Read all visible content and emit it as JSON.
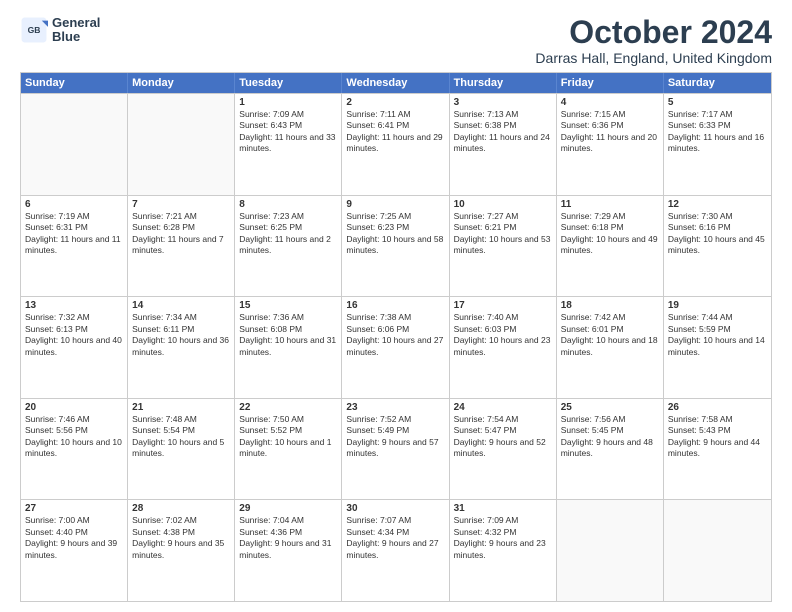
{
  "header": {
    "logo_line1": "General",
    "logo_line2": "Blue",
    "month_title": "October 2024",
    "location": "Darras Hall, England, United Kingdom"
  },
  "days_of_week": [
    "Sunday",
    "Monday",
    "Tuesday",
    "Wednesday",
    "Thursday",
    "Friday",
    "Saturday"
  ],
  "weeks": [
    [
      {
        "day": "",
        "sunrise": "",
        "sunset": "",
        "daylight": ""
      },
      {
        "day": "",
        "sunrise": "",
        "sunset": "",
        "daylight": ""
      },
      {
        "day": "1",
        "sunrise": "Sunrise: 7:09 AM",
        "sunset": "Sunset: 6:43 PM",
        "daylight": "Daylight: 11 hours and 33 minutes."
      },
      {
        "day": "2",
        "sunrise": "Sunrise: 7:11 AM",
        "sunset": "Sunset: 6:41 PM",
        "daylight": "Daylight: 11 hours and 29 minutes."
      },
      {
        "day": "3",
        "sunrise": "Sunrise: 7:13 AM",
        "sunset": "Sunset: 6:38 PM",
        "daylight": "Daylight: 11 hours and 24 minutes."
      },
      {
        "day": "4",
        "sunrise": "Sunrise: 7:15 AM",
        "sunset": "Sunset: 6:36 PM",
        "daylight": "Daylight: 11 hours and 20 minutes."
      },
      {
        "day": "5",
        "sunrise": "Sunrise: 7:17 AM",
        "sunset": "Sunset: 6:33 PM",
        "daylight": "Daylight: 11 hours and 16 minutes."
      }
    ],
    [
      {
        "day": "6",
        "sunrise": "Sunrise: 7:19 AM",
        "sunset": "Sunset: 6:31 PM",
        "daylight": "Daylight: 11 hours and 11 minutes."
      },
      {
        "day": "7",
        "sunrise": "Sunrise: 7:21 AM",
        "sunset": "Sunset: 6:28 PM",
        "daylight": "Daylight: 11 hours and 7 minutes."
      },
      {
        "day": "8",
        "sunrise": "Sunrise: 7:23 AM",
        "sunset": "Sunset: 6:25 PM",
        "daylight": "Daylight: 11 hours and 2 minutes."
      },
      {
        "day": "9",
        "sunrise": "Sunrise: 7:25 AM",
        "sunset": "Sunset: 6:23 PM",
        "daylight": "Daylight: 10 hours and 58 minutes."
      },
      {
        "day": "10",
        "sunrise": "Sunrise: 7:27 AM",
        "sunset": "Sunset: 6:21 PM",
        "daylight": "Daylight: 10 hours and 53 minutes."
      },
      {
        "day": "11",
        "sunrise": "Sunrise: 7:29 AM",
        "sunset": "Sunset: 6:18 PM",
        "daylight": "Daylight: 10 hours and 49 minutes."
      },
      {
        "day": "12",
        "sunrise": "Sunrise: 7:30 AM",
        "sunset": "Sunset: 6:16 PM",
        "daylight": "Daylight: 10 hours and 45 minutes."
      }
    ],
    [
      {
        "day": "13",
        "sunrise": "Sunrise: 7:32 AM",
        "sunset": "Sunset: 6:13 PM",
        "daylight": "Daylight: 10 hours and 40 minutes."
      },
      {
        "day": "14",
        "sunrise": "Sunrise: 7:34 AM",
        "sunset": "Sunset: 6:11 PM",
        "daylight": "Daylight: 10 hours and 36 minutes."
      },
      {
        "day": "15",
        "sunrise": "Sunrise: 7:36 AM",
        "sunset": "Sunset: 6:08 PM",
        "daylight": "Daylight: 10 hours and 31 minutes."
      },
      {
        "day": "16",
        "sunrise": "Sunrise: 7:38 AM",
        "sunset": "Sunset: 6:06 PM",
        "daylight": "Daylight: 10 hours and 27 minutes."
      },
      {
        "day": "17",
        "sunrise": "Sunrise: 7:40 AM",
        "sunset": "Sunset: 6:03 PM",
        "daylight": "Daylight: 10 hours and 23 minutes."
      },
      {
        "day": "18",
        "sunrise": "Sunrise: 7:42 AM",
        "sunset": "Sunset: 6:01 PM",
        "daylight": "Daylight: 10 hours and 18 minutes."
      },
      {
        "day": "19",
        "sunrise": "Sunrise: 7:44 AM",
        "sunset": "Sunset: 5:59 PM",
        "daylight": "Daylight: 10 hours and 14 minutes."
      }
    ],
    [
      {
        "day": "20",
        "sunrise": "Sunrise: 7:46 AM",
        "sunset": "Sunset: 5:56 PM",
        "daylight": "Daylight: 10 hours and 10 minutes."
      },
      {
        "day": "21",
        "sunrise": "Sunrise: 7:48 AM",
        "sunset": "Sunset: 5:54 PM",
        "daylight": "Daylight: 10 hours and 5 minutes."
      },
      {
        "day": "22",
        "sunrise": "Sunrise: 7:50 AM",
        "sunset": "Sunset: 5:52 PM",
        "daylight": "Daylight: 10 hours and 1 minute."
      },
      {
        "day": "23",
        "sunrise": "Sunrise: 7:52 AM",
        "sunset": "Sunset: 5:49 PM",
        "daylight": "Daylight: 9 hours and 57 minutes."
      },
      {
        "day": "24",
        "sunrise": "Sunrise: 7:54 AM",
        "sunset": "Sunset: 5:47 PM",
        "daylight": "Daylight: 9 hours and 52 minutes."
      },
      {
        "day": "25",
        "sunrise": "Sunrise: 7:56 AM",
        "sunset": "Sunset: 5:45 PM",
        "daylight": "Daylight: 9 hours and 48 minutes."
      },
      {
        "day": "26",
        "sunrise": "Sunrise: 7:58 AM",
        "sunset": "Sunset: 5:43 PM",
        "daylight": "Daylight: 9 hours and 44 minutes."
      }
    ],
    [
      {
        "day": "27",
        "sunrise": "Sunrise: 7:00 AM",
        "sunset": "Sunset: 4:40 PM",
        "daylight": "Daylight: 9 hours and 39 minutes."
      },
      {
        "day": "28",
        "sunrise": "Sunrise: 7:02 AM",
        "sunset": "Sunset: 4:38 PM",
        "daylight": "Daylight: 9 hours and 35 minutes."
      },
      {
        "day": "29",
        "sunrise": "Sunrise: 7:04 AM",
        "sunset": "Sunset: 4:36 PM",
        "daylight": "Daylight: 9 hours and 31 minutes."
      },
      {
        "day": "30",
        "sunrise": "Sunrise: 7:07 AM",
        "sunset": "Sunset: 4:34 PM",
        "daylight": "Daylight: 9 hours and 27 minutes."
      },
      {
        "day": "31",
        "sunrise": "Sunrise: 7:09 AM",
        "sunset": "Sunset: 4:32 PM",
        "daylight": "Daylight: 9 hours and 23 minutes."
      },
      {
        "day": "",
        "sunrise": "",
        "sunset": "",
        "daylight": ""
      },
      {
        "day": "",
        "sunrise": "",
        "sunset": "",
        "daylight": ""
      }
    ]
  ]
}
